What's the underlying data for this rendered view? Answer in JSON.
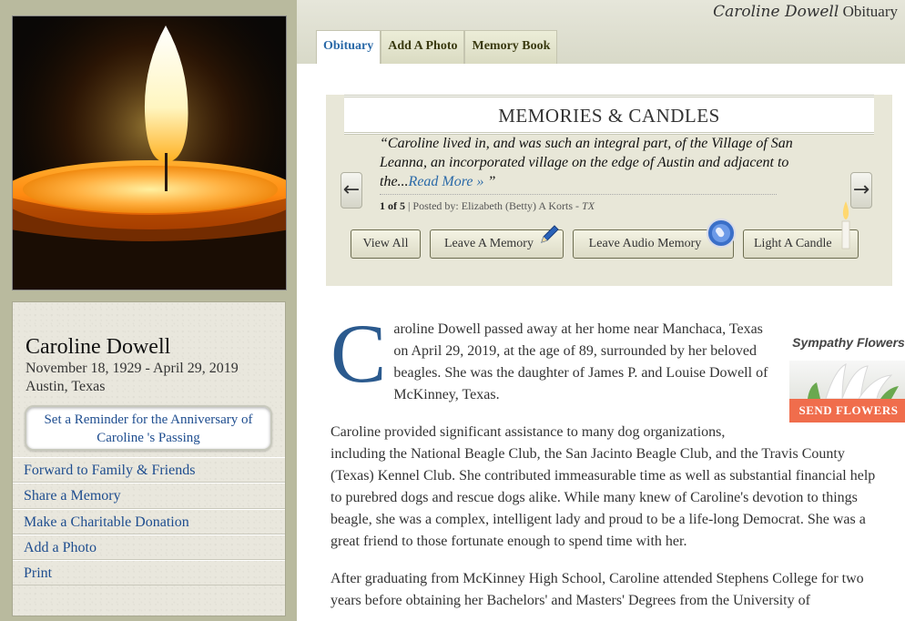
{
  "header": {
    "obituary_title_name": "Caroline Dowell",
    "obituary_title_suffix": "Obituary"
  },
  "tabs": [
    {
      "label": "Obituary",
      "active": true
    },
    {
      "label": "Add A Photo",
      "active": false
    },
    {
      "label": "Memory Book",
      "active": false
    }
  ],
  "person": {
    "name": "Caroline Dowell",
    "dates": "November 18, 1929 - April 29, 2019",
    "location": "Austin, Texas"
  },
  "sidebar": {
    "reminder_label": "Set a Reminder for the Anniversary of Caroline 's Passing",
    "links": [
      {
        "label": "Forward to Family & Friends"
      },
      {
        "label": "Share a Memory"
      },
      {
        "label": "Make a Charitable Donation"
      },
      {
        "label": "Add a Photo"
      },
      {
        "label": "Print"
      }
    ]
  },
  "memories": {
    "heading": "MEMORIES & CANDLES",
    "quote": "“Caroline lived in, and was such an integral part, of the Village of San Leanna, an incorporated village on the edge of Austin and adjacent to the...",
    "read_more": "Read More »",
    "quote_end": " ”",
    "counter": "1 of 5",
    "posted_by": " | Posted by: Elizabeth (Betty) A Korts - ",
    "state": "TX",
    "buttons": {
      "view_all": "View All",
      "leave_memory": "Leave A Memory",
      "leave_audio": "Leave Audio Memory",
      "light_candle": "Light A Candle"
    },
    "prev_arrow": "←",
    "next_arrow": "→"
  },
  "flowers": {
    "title": "Sympathy Flowers",
    "button": "SEND FLOWERS"
  },
  "obituary": {
    "drop_cap": "C",
    "p1": "aroline Dowell passed away at her home near Manchaca, Texas on April 29, 2019, at the age of 89, surrounded by her beloved beagles. She was the daughter of James P. and Louise Dowell of McKinney, Texas.",
    "p2": "Caroline provided significant assistance to many dog organizations, including the National Beagle Club, the San Jacinto Beagle Club, and the Travis County (Texas) Kennel Club. She contributed immeasurable time as well as substantial financial help to purebred dogs and rescue dogs alike. While many knew of Caroline's devotion to things beagle, she was a complex, intelligent lady and proud to be a life-long Democrat. She was a great friend to those fortunate enough to spend time with her.",
    "p3": "After graduating from McKinney High School, Caroline attended Stephens College for two years before obtaining her Bachelors' and Masters' Degrees from the University of"
  }
}
